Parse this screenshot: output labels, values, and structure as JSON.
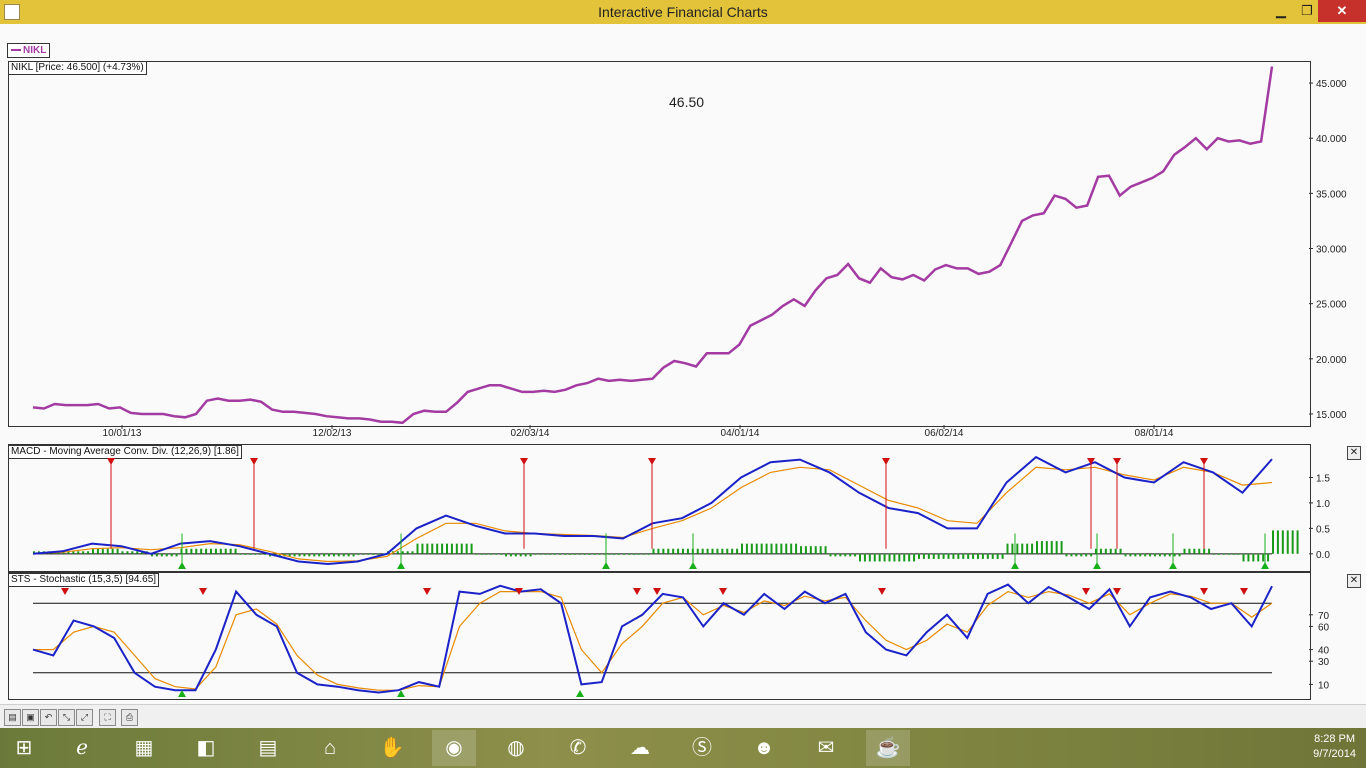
{
  "window": {
    "title": "Interactive Financial Charts",
    "minimize": "▁",
    "maximize": "❐",
    "close": "✕"
  },
  "legend": {
    "symbol": "NIKL"
  },
  "price_panel": {
    "label": "NIKL [Price: 46.500] (+4.73%)",
    "readout": "46.50",
    "y_ticks": [
      "45.000",
      "40.000",
      "35.000",
      "30.000",
      "25.000",
      "20.000",
      "15.000"
    ],
    "x_ticks": [
      "10/01/13",
      "12/02/13",
      "02/03/14",
      "04/01/14",
      "06/02/14",
      "08/01/14"
    ],
    "line_color": "#a33ba3"
  },
  "macd_panel": {
    "label": "MACD - Moving Average Conv. Div. (12,26,9) [1.86]",
    "y_ticks": [
      "1.5",
      "1.0",
      "0.5",
      "0.0"
    ],
    "close": "✕"
  },
  "sts_panel": {
    "label": "STS - Stochastic (15,3,5) [94.65]",
    "y_ticks": [
      "70",
      "60",
      "40",
      "30",
      "10"
    ],
    "close": "✕"
  },
  "toolbar": {
    "buttons": [
      "open-icon",
      "save-icon",
      "undo-icon",
      "zoom-out-icon",
      "zoom-fit-icon",
      "fullscreen-icon",
      "print-icon"
    ]
  },
  "taskbar": {
    "apps": [
      "start-icon",
      "ie-icon",
      "explorer-icon",
      "store-icon",
      "notes-icon",
      "home-icon",
      "game-icon",
      "chrome-icon",
      "firefox-icon",
      "viber-icon",
      "messenger-icon",
      "skype-icon",
      "chat-icon",
      "mail-icon",
      "java-icon"
    ],
    "time": "8:28 PM",
    "date": "9/7/2014"
  },
  "chart_data": [
    {
      "type": "line",
      "title": "NIKL [Price: 46.500] (+4.73%)",
      "series": [
        {
          "name": "NIKL",
          "values": [
            15.6,
            15.5,
            15.9,
            15.8,
            15.8,
            15.8,
            15.9,
            15.5,
            15.6,
            15.1,
            15.0,
            15.0,
            15.0,
            14.8,
            14.7,
            15.0,
            16.2,
            16.4,
            16.2,
            16.2,
            16.3,
            16.1,
            15.4,
            15.2,
            15.2,
            15.1,
            15.0,
            14.8,
            14.7,
            14.6,
            14.6,
            14.5,
            14.3,
            14.3,
            14.2,
            15.0,
            15.3,
            15.2,
            15.2,
            16.0,
            17.0,
            17.3,
            17.6,
            17.6,
            17.3,
            17.0,
            17.0,
            17.1,
            17.0,
            17.2,
            17.6,
            17.8,
            18.2,
            18.0,
            18.1,
            18.0,
            18.1,
            18.2,
            19.2,
            19.8,
            19.6,
            19.3,
            20.5,
            20.5,
            20.5,
            21.3,
            23.0,
            23.5,
            24.0,
            24.8,
            25.4,
            24.8,
            26.2,
            27.3,
            27.6,
            28.6,
            27.3,
            26.9,
            28.2,
            27.4,
            27.2,
            27.6,
            27.1,
            28.1,
            28.5,
            28.2,
            28.2,
            27.7,
            27.9,
            28.5,
            30.5,
            32.5,
            33.0,
            33.2,
            34.8,
            34.5,
            33.7,
            33.9,
            36.5,
            36.6,
            34.8,
            35.6,
            36.0,
            36.4,
            37.0,
            38.5,
            39.2,
            40.0,
            39.0,
            40.0,
            39.7,
            39.8,
            39.5,
            39.7,
            46.5
          ]
        }
      ],
      "x_tick_labels": [
        "10/01/13",
        "12/02/13",
        "02/03/14",
        "04/01/14",
        "06/02/14",
        "08/01/14"
      ],
      "ylim": [
        14.0,
        47.0
      ],
      "legend": "top-left"
    },
    {
      "type": "line",
      "title": "MACD - Moving Average Conv. Div. (12,26,9) [1.86]",
      "series": [
        {
          "name": "MACD",
          "values": [
            0.0,
            0.05,
            0.2,
            0.15,
            0.0,
            0.2,
            0.25,
            0.15,
            0.0,
            -0.15,
            -0.2,
            -0.15,
            0.0,
            0.5,
            0.75,
            0.55,
            0.4,
            0.4,
            0.35,
            0.35,
            0.3,
            0.6,
            0.7,
            1.0,
            1.5,
            1.8,
            1.85,
            1.6,
            1.2,
            0.9,
            0.8,
            0.5,
            0.5,
            1.4,
            1.9,
            1.6,
            1.8,
            1.5,
            1.4,
            1.8,
            1.6,
            1.2,
            1.86
          ]
        },
        {
          "name": "Signal",
          "values": [
            0.0,
            0.03,
            0.1,
            0.12,
            0.08,
            0.12,
            0.2,
            0.18,
            0.05,
            -0.1,
            -0.15,
            -0.14,
            -0.05,
            0.3,
            0.6,
            0.6,
            0.45,
            0.4,
            0.38,
            0.36,
            0.32,
            0.5,
            0.65,
            0.9,
            1.3,
            1.6,
            1.7,
            1.65,
            1.35,
            1.05,
            0.9,
            0.65,
            0.6,
            1.2,
            1.7,
            1.65,
            1.7,
            1.55,
            1.45,
            1.7,
            1.6,
            1.35,
            1.4
          ]
        }
      ],
      "histogram": [
        0.05,
        0.05,
        0.1,
        0.05,
        -0.05,
        0.1,
        0.1,
        0.0,
        -0.05,
        -0.05,
        -0.05,
        -0.02,
        0.05,
        0.2,
        0.2,
        0.0,
        -0.05,
        0.0,
        -0.02,
        -0.01,
        0.0,
        0.1,
        0.1,
        0.1,
        0.2,
        0.2,
        0.15,
        -0.05,
        -0.15,
        -0.15,
        -0.1,
        -0.1,
        -0.1,
        0.2,
        0.25,
        -0.05,
        0.1,
        -0.05,
        -0.05,
        0.1,
        0.0,
        -0.15,
        0.46
      ],
      "ylim": [
        -0.2,
        2.0
      ],
      "buy_signals": 8,
      "sell_signals": 8
    },
    {
      "type": "line",
      "title": "STS - Stochastic (15,3,5) [94.65]",
      "series": [
        {
          "name": "%K",
          "values": [
            40,
            35,
            65,
            60,
            50,
            20,
            8,
            5,
            5,
            40,
            90,
            70,
            60,
            20,
            10,
            8,
            5,
            3,
            5,
            12,
            8,
            90,
            88,
            95,
            90,
            92,
            80,
            10,
            12,
            60,
            70,
            88,
            85,
            60,
            80,
            70,
            88,
            75,
            90,
            80,
            88,
            55,
            40,
            35,
            55,
            70,
            50,
            88,
            96,
            80,
            94,
            85,
            75,
            92,
            60,
            85,
            90,
            85,
            75,
            80,
            60,
            94.65
          ]
        },
        {
          "name": "%D",
          "values": [
            40,
            40,
            55,
            60,
            55,
            35,
            15,
            8,
            6,
            25,
            70,
            75,
            62,
            35,
            18,
            10,
            7,
            5,
            5,
            9,
            8,
            60,
            80,
            90,
            90,
            90,
            85,
            40,
            20,
            45,
            60,
            80,
            85,
            70,
            78,
            72,
            82,
            78,
            86,
            82,
            85,
            65,
            48,
            40,
            48,
            62,
            55,
            78,
            90,
            85,
            90,
            87,
            80,
            88,
            70,
            80,
            88,
            86,
            80,
            80,
            68,
            80
          ]
        }
      ],
      "ylim": [
        0,
        100
      ],
      "reference_lines": [
        80,
        20
      ]
    }
  ]
}
